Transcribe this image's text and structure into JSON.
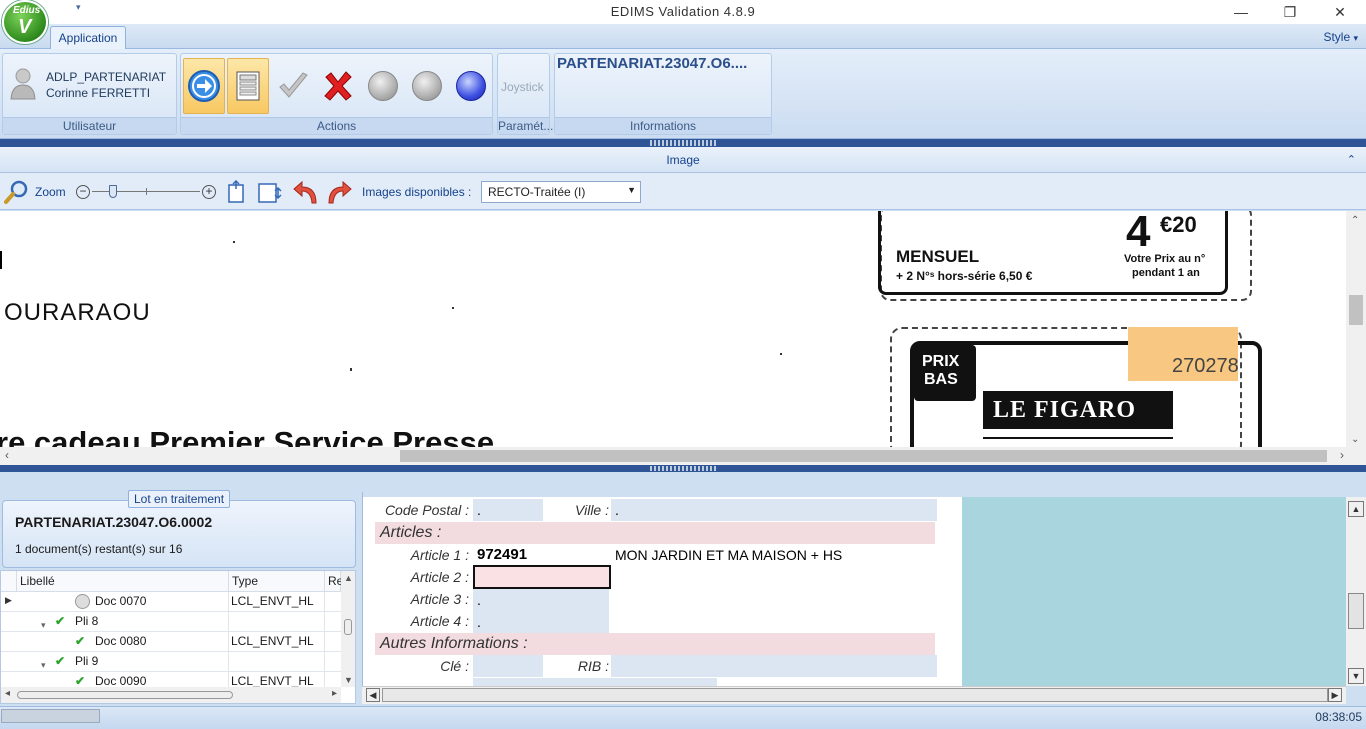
{
  "window": {
    "title": "EDIMS Validation 4.8.9",
    "minimize": "—",
    "maximize": "❐",
    "close": "✕"
  },
  "logo": {
    "text_top": "Edius",
    "text_main": "V"
  },
  "ribbon": {
    "tab": "Application",
    "style_menu": "Style",
    "user": {
      "login": "ADLP_PARTENARIAT",
      "name": "Corinne FERRETTI",
      "group_label": "Utilisateur"
    },
    "actions_label": "Actions",
    "params": {
      "joystick": "Joystick",
      "group_label": "Paramét..."
    },
    "info": {
      "title": "PARTENARIAT.23047.O6....",
      "group_label": "Informations"
    }
  },
  "image_panel": {
    "header": "Image",
    "zoom_label": "Zoom",
    "images_label": "Images disponibles :",
    "images_selected": "RECTO-Traitée (I)",
    "doc": {
      "line_mensuel": "MENSUEL",
      "line_hs": "+ 2 N°ˢ hors-série 6,50 €",
      "price_int": "4",
      "price_dec": "€20",
      "price_note1": "Votre Prix au n°",
      "price_note2": "pendant 1 an",
      "name_fragment": "OURARAOU",
      "headline": "re cadeau Premier Service Presse",
      "prix": "PRIX",
      "bas": "BAS",
      "figaro": "LE FIGARO",
      "code": "270278"
    }
  },
  "lot": {
    "legend": "Lot en traitement",
    "title": "PARTENARIAT.23047.O6.0002",
    "remaining": "1 document(s) restant(s) sur 16"
  },
  "grid": {
    "columns": [
      "Libellé",
      "Type",
      "Re"
    ],
    "rows": [
      {
        "label": "Doc 0070",
        "type": "LCL_ENVT_HL",
        "icon": "pending-icon",
        "indent": 2,
        "current": true
      },
      {
        "label": "Pli 8",
        "type": "",
        "icon": "check-icon",
        "indent": 1,
        "expand": true
      },
      {
        "label": "Doc 0080",
        "type": "LCL_ENVT_HL",
        "icon": "check-icon",
        "indent": 2
      },
      {
        "label": "Pli 9",
        "type": "",
        "icon": "check-icon",
        "indent": 1,
        "expand": true
      },
      {
        "label": "Doc 0090",
        "type": "LCL_ENVT_HL",
        "icon": "check-icon",
        "indent": 2
      }
    ]
  },
  "form": {
    "code_postal_label": "Code Postal :",
    "code_postal_value": ".",
    "ville_label": "Ville :",
    "ville_value": ".",
    "section_articles": "Articles :",
    "article1_label": "Article 1 :",
    "article1_code": "972491",
    "article1_desc": "MON JARDIN ET MA MAISON + HS",
    "article2_label": "Article 2 :",
    "article2_value": "",
    "article3_label": "Article 3 :",
    "article3_value": ".",
    "article4_label": "Article 4 :",
    "article4_value": ".",
    "section_autres": "Autres Informations :",
    "cle_label": "Clé :",
    "rib_label": "RIB :"
  },
  "status": {
    "time": "08:38:05"
  }
}
